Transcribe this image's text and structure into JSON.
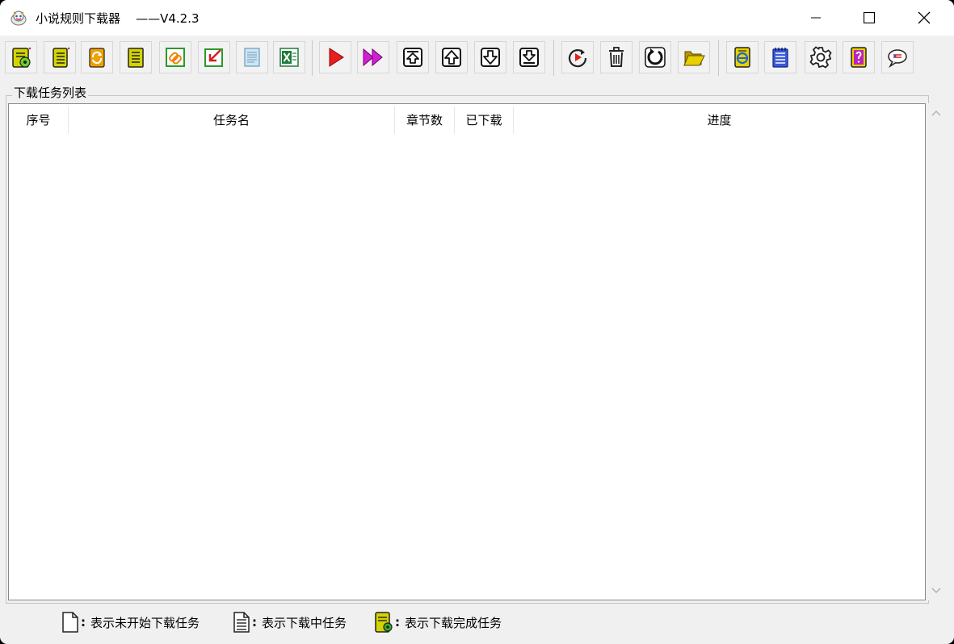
{
  "window": {
    "title": "小说规则下载器",
    "version": "——V4.2.3"
  },
  "toolbar": {
    "buttons": [
      {
        "icon": "gear-book-icon",
        "name": "toolbar-rule-settings-button"
      },
      {
        "icon": "notebook-icon",
        "name": "toolbar-new-task-button"
      },
      {
        "icon": "refresh-book-icon",
        "name": "toolbar-update-button"
      },
      {
        "icon": "book-list-icon",
        "name": "toolbar-book-list-button"
      },
      {
        "icon": "link-icon",
        "name": "toolbar-link-button"
      },
      {
        "icon": "import-icon",
        "name": "toolbar-import-button"
      },
      {
        "icon": "text-file-icon",
        "name": "toolbar-text-button"
      },
      {
        "icon": "excel-icon",
        "name": "toolbar-excel-button"
      },
      {
        "icon": "play-icon",
        "name": "toolbar-start-button"
      },
      {
        "icon": "fast-forward-icon",
        "name": "toolbar-start-all-button"
      },
      {
        "icon": "move-top-icon",
        "name": "toolbar-move-top-button"
      },
      {
        "icon": "move-up-icon",
        "name": "toolbar-move-up-button"
      },
      {
        "icon": "move-down-icon",
        "name": "toolbar-move-down-button"
      },
      {
        "icon": "move-bottom-icon",
        "name": "toolbar-move-bottom-button"
      },
      {
        "icon": "replay-icon",
        "name": "toolbar-restart-button"
      },
      {
        "icon": "trash-icon",
        "name": "toolbar-delete-button"
      },
      {
        "icon": "reload-icon",
        "name": "toolbar-reload-button"
      },
      {
        "icon": "folder-icon",
        "name": "toolbar-open-folder-button"
      },
      {
        "icon": "browser-icon",
        "name": "toolbar-browser-button"
      },
      {
        "icon": "notepad-icon",
        "name": "toolbar-notepad-button"
      },
      {
        "icon": "gear-icon",
        "name": "toolbar-settings-button"
      },
      {
        "icon": "help-book-icon",
        "name": "toolbar-help-button"
      },
      {
        "icon": "chat-bubble-icon",
        "name": "toolbar-feedback-button"
      }
    ]
  },
  "task_list": {
    "group_title": "下载任务列表",
    "columns": [
      "序号",
      "任务名",
      "章节数",
      "已下载",
      "进度"
    ],
    "rows": []
  },
  "status_legend": {
    "not_started": "表示未开始下载任务",
    "downloading": "表示下载中任务",
    "completed": "表示下载完成任务"
  },
  "colors": {
    "window_bg": "#f0f0f0",
    "titlebar_bg": "#ffffff",
    "list_bg": "#ffffff"
  }
}
